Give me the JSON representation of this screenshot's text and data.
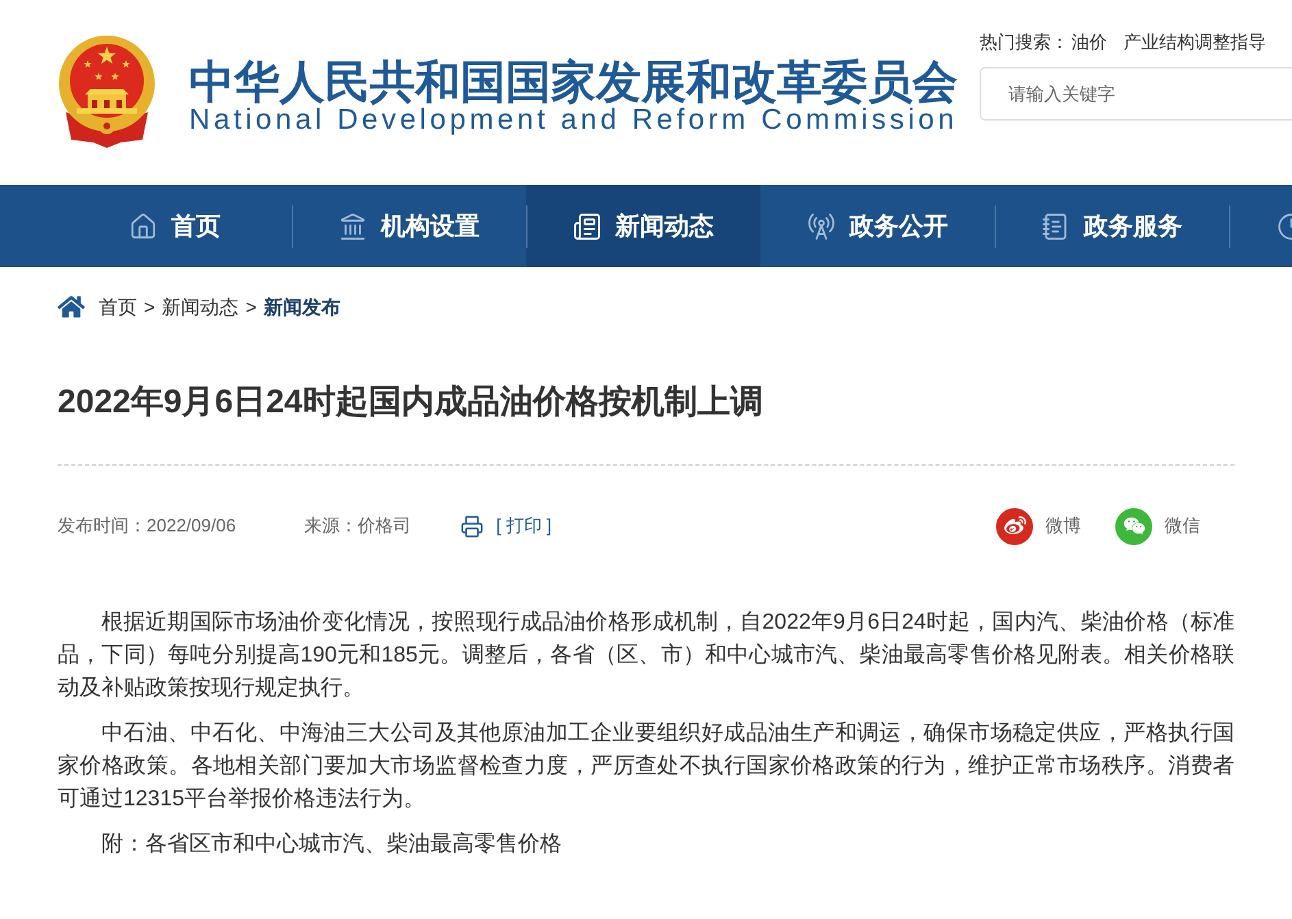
{
  "header": {
    "title_zh": "中华人民共和国国家发展和改革委员会",
    "title_en": "National Development and Reform Commission",
    "hot_search": {
      "label": "热门搜索：",
      "links": [
        "油价",
        "产业结构调整指导"
      ]
    },
    "search": {
      "placeholder": "请输入关键字"
    }
  },
  "nav": {
    "items": [
      {
        "label": "首页",
        "selected": false
      },
      {
        "label": "机构设置",
        "selected": false
      },
      {
        "label": "新闻动态",
        "selected": true
      },
      {
        "label": "政务公开",
        "selected": false
      },
      {
        "label": "政务服务",
        "selected": false
      },
      {
        "selected": false
      }
    ]
  },
  "breadcrumb": [
    {
      "label": "首页",
      "current": false
    },
    {
      "separator": ">",
      "label": "新闻动态",
      "current": false
    },
    {
      "separator": ">",
      "label": "新闻发布",
      "current": true
    }
  ],
  "article": {
    "title": "2022年9月6日24时起国内成品油价格按机制上调",
    "meta": {
      "published": "发布时间：2022/09/06",
      "source": "来源：价格司",
      "print": "[ 打印 ]"
    },
    "share": [
      {
        "kind": "weibo",
        "label": "微博"
      },
      {
        "kind": "wechat",
        "label": "微信"
      }
    ],
    "paragraphs": [
      "根据近期国际市场油价变化情况，按照现行成品油价格形成机制，自2022年9月6日24时起，国内汽、柴油价格（标准品，下同）每吨分别提高190元和185元。调整后，各省（区、市）和中心城市汽、柴油最高零售价格见附表。相关价格联动及补贴政策按现行规定执行。",
      "中石油、中石化、中海油三大公司及其他原油加工企业要组织好成品油生产和调运，确保市场稳定供应，严格执行国家价格政策。各地相关部门要加大市场监督检查力度，严厉查处不执行国家价格政策的行为，维护正常市场秩序。消费者可通过12315平台举报价格违法行为。",
      "附：各省区市和中心城市汽、柴油最高零售价格"
    ]
  }
}
